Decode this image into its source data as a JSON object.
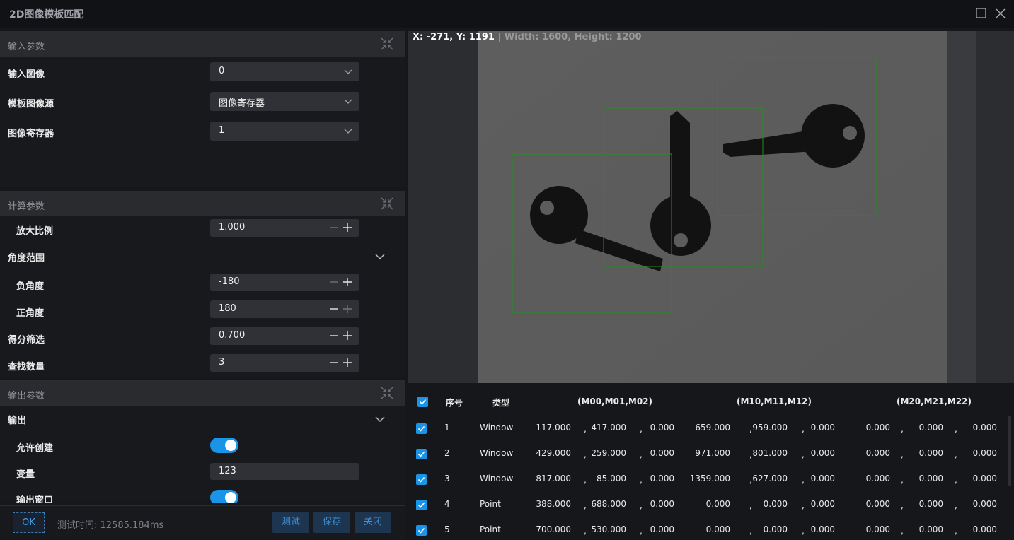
{
  "window": {
    "title": "2D图像模板匹配",
    "maximize_icon": "square-icon",
    "close_icon": "close-icon"
  },
  "input_section": {
    "title": "输入参数",
    "rows": [
      {
        "label": "输入图像",
        "value": "0"
      },
      {
        "label": "模板图像源",
        "value": "图像寄存器"
      },
      {
        "label": "图像寄存器",
        "value": "1"
      }
    ]
  },
  "calc_section": {
    "title": "计算参数",
    "scale": {
      "label": "放大比例",
      "value": "1.000"
    },
    "angle_range": {
      "label": "角度范围"
    },
    "neg_angle": {
      "label": "负角度",
      "value": "-180"
    },
    "pos_angle": {
      "label": "正角度",
      "value": "180"
    },
    "score": {
      "label": "得分筛选",
      "value": "0.700"
    },
    "count": {
      "label": "查找数量",
      "value": "3"
    }
  },
  "output_section": {
    "title": "输出参数",
    "output": {
      "label": "输出"
    },
    "allow_create": {
      "label": "允许创建",
      "on": true
    },
    "variable": {
      "label": "变量",
      "value": "123"
    },
    "output_window": {
      "label": "输出窗口",
      "on": true
    }
  },
  "footer": {
    "ok": "OK",
    "test_time": "测试时间: 12585.184ms",
    "test": "测试",
    "save": "保存",
    "close": "关闭"
  },
  "viewer": {
    "coord": "X: -271, Y: 1191",
    "size": " | Width: 1600, Height: 1200"
  },
  "table": {
    "headers": {
      "index": "序号",
      "type": "类型",
      "m0": "(M00,M01,M02)",
      "m1": "(M10,M11,M12)",
      "m2": "(M20,M21,M22)"
    },
    "rows": [
      {
        "idx": "1",
        "type": "Window",
        "v": [
          "117.000",
          "417.000",
          "0.000",
          "659.000",
          "959.000",
          "0.000",
          "0.000",
          "0.000",
          "0.000"
        ]
      },
      {
        "idx": "2",
        "type": "Window",
        "v": [
          "429.000",
          "259.000",
          "0.000",
          "971.000",
          "801.000",
          "0.000",
          "0.000",
          "0.000",
          "0.000"
        ]
      },
      {
        "idx": "3",
        "type": "Window",
        "v": [
          "817.000",
          "85.000",
          "0.000",
          "1359.000",
          "627.000",
          "0.000",
          "0.000",
          "0.000",
          "0.000"
        ]
      },
      {
        "idx": "4",
        "type": "Point",
        "v": [
          "388.000",
          "688.000",
          "0.000",
          "0.000",
          "0.000",
          "0.000",
          "0.000",
          "0.000",
          "0.000"
        ]
      },
      {
        "idx": "5",
        "type": "Point",
        "v": [
          "700.000",
          "530.000",
          "0.000",
          "0.000",
          "0.000",
          "0.000",
          "0.000",
          "0.000",
          "0.000"
        ]
      }
    ]
  }
}
